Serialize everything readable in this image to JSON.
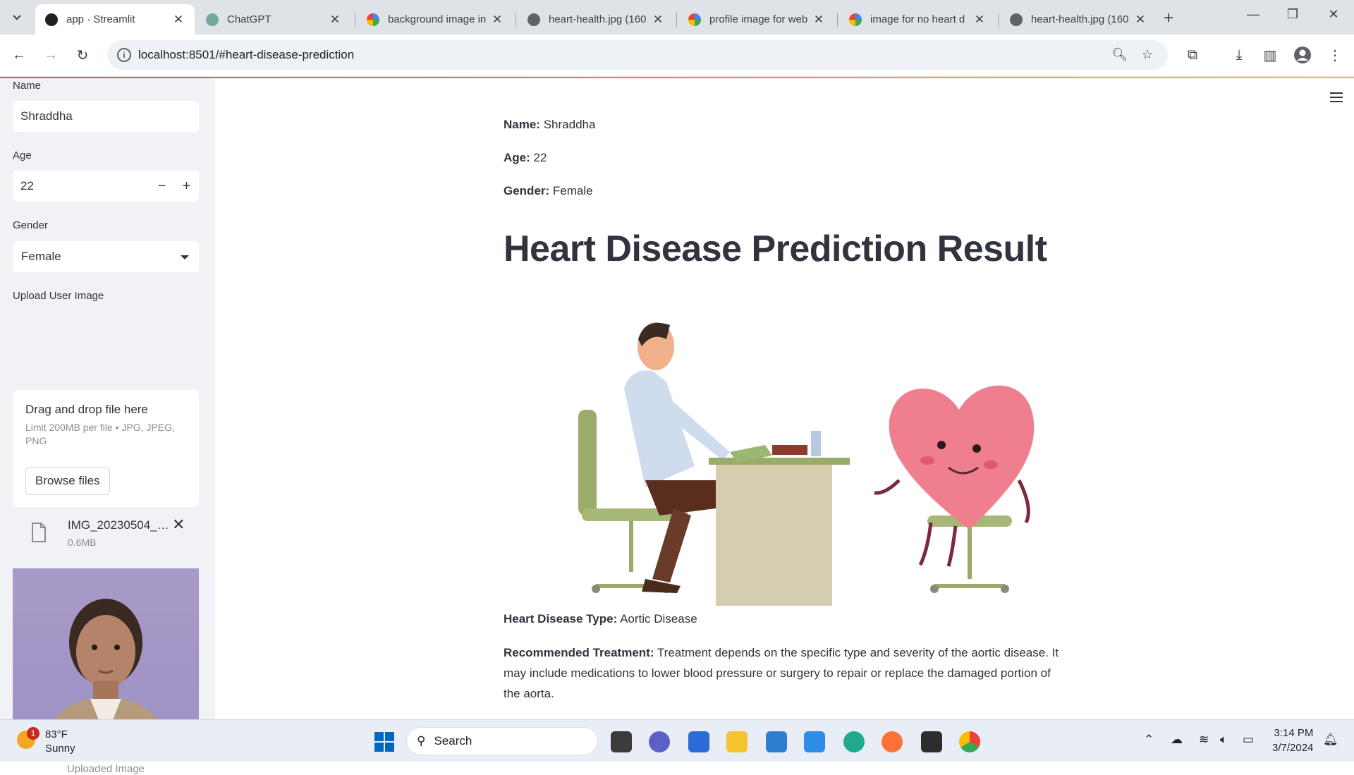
{
  "browser": {
    "tabs": [
      {
        "title": "app · Streamlit",
        "active": true
      },
      {
        "title": "ChatGPT",
        "active": false
      },
      {
        "title": "background image in",
        "active": false
      },
      {
        "title": "heart-health.jpg (160",
        "active": false
      },
      {
        "title": "profile image for web",
        "active": false
      },
      {
        "title": "image for no heart d",
        "active": false
      },
      {
        "title": "heart-health.jpg (160",
        "active": false
      }
    ],
    "url": "localhost:8501/#heart-disease-prediction"
  },
  "sidebar": {
    "name_label": "Name",
    "name_value": "Shraddha",
    "age_label": "Age",
    "age_value": "22",
    "gender_label": "Gender",
    "gender_value": "Female",
    "upload_label": "Upload User Image",
    "dropzone_title": "Drag and drop file here",
    "dropzone_limit": "Limit 200MB per file • JPG, JPEG, PNG",
    "browse_label": "Browse files",
    "file_name": "IMG_20230504_1...",
    "file_size": "0.6MB",
    "image_caption": "Uploaded Image"
  },
  "main": {
    "name_key": "Name:",
    "name_val": "Shraddha",
    "age_key": "Age:",
    "age_val": "22",
    "gender_key": "Gender:",
    "gender_val": "Female",
    "title": "Heart Disease Prediction Result",
    "type_key": "Heart Disease Type:",
    "type_val": "Aortic Disease",
    "treatment_key": "Recommended Treatment:",
    "treatment_val": "Treatment depends on the specific type and severity of the aortic disease. It may include medications to lower blood pressure or surgery to repair or replace the damaged portion of the aorta."
  },
  "taskbar": {
    "weather_badge": "1",
    "temperature": "83°F",
    "condition": "Sunny",
    "search_label": "Search",
    "time": "3:14 PM",
    "date": "3/7/2024"
  },
  "colors": {
    "accent": "#ff4b4b",
    "sidebar_bg": "#f0f2f6",
    "text": "#31333f"
  }
}
